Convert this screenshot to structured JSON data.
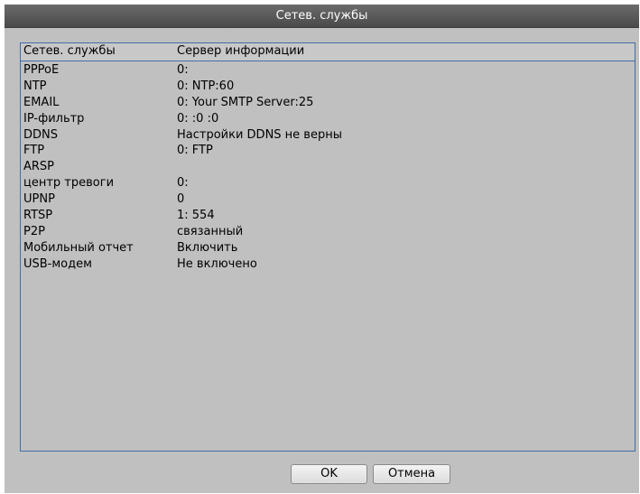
{
  "window": {
    "title": "Сетев. службы"
  },
  "table": {
    "headers": [
      "Сетев. службы",
      "Сервер информации"
    ],
    "rows": [
      {
        "service": "PPPoE",
        "info": "0:"
      },
      {
        "service": "NTP",
        "info": "0: NTP:60"
      },
      {
        "service": "EMAIL",
        "info": "0: Your SMTP Server:25"
      },
      {
        "service": "IP-фильтр",
        "info": "0: :0 :0"
      },
      {
        "service": "DDNS",
        "info": "Настройки DDNS не верны"
      },
      {
        "service": "FTP",
        "info": "0: FTP"
      },
      {
        "service": "ARSP",
        "info": ""
      },
      {
        "service": "центр тревоги",
        "info": "0:"
      },
      {
        "service": "UPNP",
        "info": "0"
      },
      {
        "service": "RTSP",
        "info": "1: 554"
      },
      {
        "service": "P2P",
        "info": "связанный"
      },
      {
        "service": "Мобильный отчет",
        "info": "Включить"
      },
      {
        "service": "USB-модем",
        "info": "Не включено"
      }
    ]
  },
  "buttons": {
    "ok_label": "OK",
    "cancel_label": "Отмена"
  }
}
